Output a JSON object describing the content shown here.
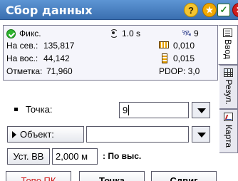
{
  "window": {
    "title": "Сбор данных",
    "buttons": [
      "help-icon",
      "star-icon",
      "check-icon",
      "close-icon"
    ]
  },
  "status": {
    "fix_label": "Фикс.",
    "latency": "1.0 s",
    "satellites": "9",
    "north_label": "На сев.:",
    "north_value": "135,817",
    "east_label": "На вос.:",
    "east_value": "44,142",
    "elev_label": "Отметка:",
    "elev_value": "71,960",
    "h_precision": "0,010",
    "v_precision": "0,015",
    "pdop": "PDOP: 3,0"
  },
  "tabs": [
    {
      "label": "Ввод",
      "icon": "form-icon",
      "active": true
    },
    {
      "label": "Резул.",
      "icon": "grid-icon",
      "active": false
    },
    {
      "label": "Карта",
      "icon": "map-icon",
      "active": false
    }
  ],
  "form": {
    "point_label": "Точка:",
    "point_value": "9",
    "object_label": "Объект:",
    "object_value": "",
    "antenna_button": "Уст. ВВ",
    "antenna_height": "2,000 м",
    "measure_method": ": По выс."
  },
  "actions": {
    "topo_label": "Топо ПК",
    "point_label": "Точка",
    "offset_label": "Сдвиг"
  },
  "colors": {
    "titlebar": "#3a6fb0",
    "topo_text": "#d01818"
  }
}
